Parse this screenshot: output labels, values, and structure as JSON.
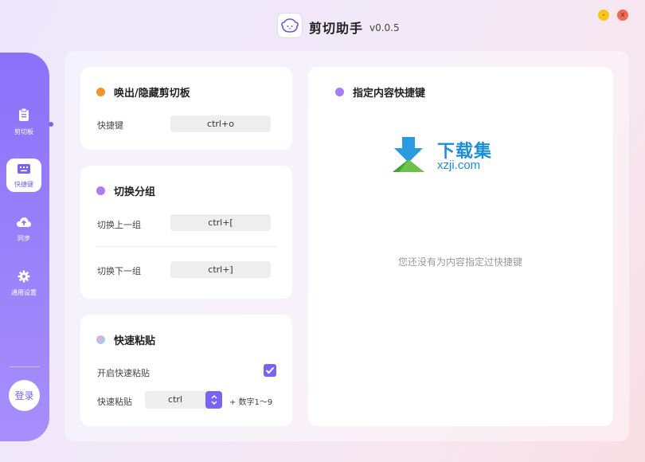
{
  "app": {
    "title": "剪切助手",
    "version": "v0.0.5"
  },
  "window": {
    "minimize": "-",
    "close": "x"
  },
  "sidebar": {
    "items": [
      {
        "label": "剪切板",
        "icon": "clipboard-icon"
      },
      {
        "label": "快捷键",
        "icon": "keyboard-icon",
        "active": true
      },
      {
        "label": "同步",
        "icon": "cloud-upload-icon"
      },
      {
        "label": "通用设置",
        "icon": "gear-icon"
      }
    ],
    "login": "登录"
  },
  "cards": {
    "toggle_clipboard": {
      "title": "唤出/隐藏剪切板",
      "dot_color": "#f5922e",
      "rows": [
        {
          "label": "快捷键",
          "key": "ctrl+o"
        }
      ]
    },
    "switch_group": {
      "title": "切换分组",
      "dot_color": "#a77cf7",
      "rows": [
        {
          "label": "切换上一组",
          "key": "ctrl+["
        },
        {
          "label": "切换下一组",
          "key": "ctrl+]"
        }
      ]
    },
    "quick_paste": {
      "title": "快速粘贴",
      "dot_color": "#9ad4f0",
      "enable_label": "开启快速粘贴",
      "enabled": true,
      "paste_label": "快速粘贴",
      "modifier_value": "ctrl",
      "suffix": "+ 数字1～9"
    },
    "content_shortcuts": {
      "title": "指定内容快捷键",
      "dot_color": "#a77cf7",
      "empty_text": "您还没有为内容指定过快捷键"
    }
  },
  "watermark": {
    "cn": "下载集",
    "en": "xzji.com"
  },
  "colors": {
    "accent": "#7a62f2",
    "sidebar": "#8a72fb"
  }
}
